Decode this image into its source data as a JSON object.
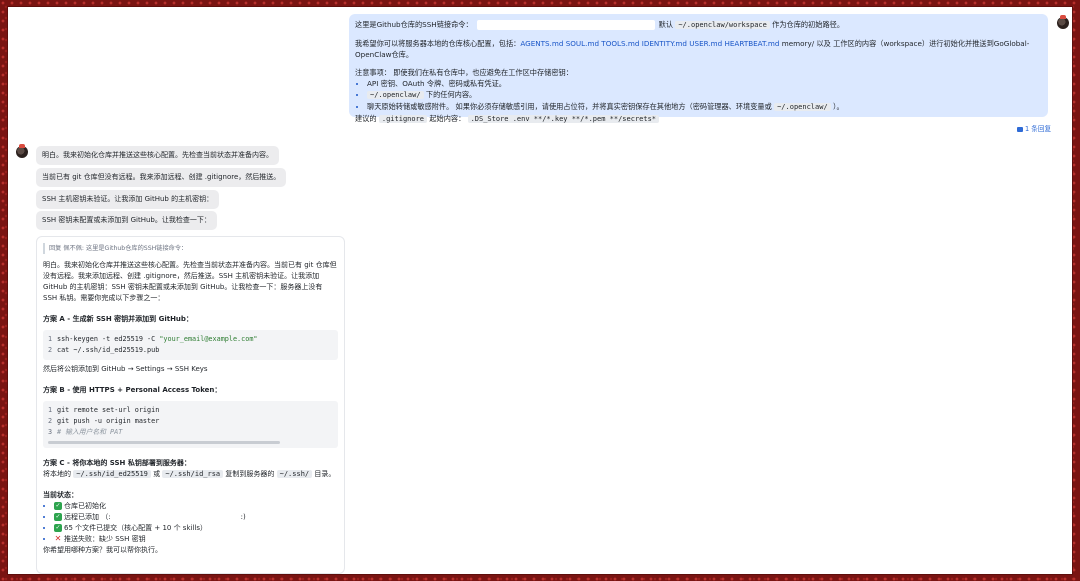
{
  "user_message": {
    "line1_prefix": "这里是Github仓库的SSH链接命令：",
    "line1_default": "默认",
    "line1_path": "~/.openclaw/workspace",
    "line1_suffix": "作为仓库的初始路径。",
    "line2_prefix": "我希望你可以将服务器本地的仓库核心配置，包括：",
    "line2_files": "AGENTS.md SOUL.md TOOLS.md IDENTITY.md USER.md HEARTBEAT.md",
    "line2_suffix": "memory/ 以及 工作区的内容（workspace）进行初始化并推送到GoGlobal-OpenClaw仓库。",
    "notes_title": "注意事项： 即使我们在私有仓库中，也应避免在工作区中存储密钥：",
    "notes": [
      {
        "text": "API 密钥、OAuth 令牌、密码或私有凭证。",
        "code": "",
        "tail": ""
      },
      {
        "text": "",
        "code": "~/.openclaw/",
        "tail": "下的任何内容。"
      },
      {
        "text": "聊天原始转储或敏感附件。 如果你必须存储敏感引用，请使用占位符，并将真实密钥保存在其他地方（密码管理器、环境变量或",
        "code": "~/.openclaw/",
        "tail": "）。"
      }
    ],
    "gitignore_label": "建议的",
    "gitignore_file": ".gitignore",
    "gitignore_mid": "起始内容：",
    "gitignore_content": ".DS_Store .env **/*.key **/*.pem **/secrets*"
  },
  "reply_count": "1 条回复",
  "assistant_bubbles": [
    "明白。我来初始化仓库并推送这些核心配置。先检查当前状态并准备内容。",
    "当前已有 git 仓库但没有远程。我来添加远程、创建 .gitignore，然后推送。",
    "SSH 主机密钥未验证。让我添加 GitHub 的主机密钥：",
    "SSH 密钥未配置或未添加到 GitHub。让我检查一下："
  ],
  "card": {
    "quote": "回复 佩不佩: 这里是Github仓库的SSH链接命令：",
    "summary": "明白。我来初始化仓库并推送这些核心配置。先检查当前状态并准备内容。当前已有 git 仓库但没有远程。我来添加远程、创建 .gitignore，然后推送。SSH 主机密钥未验证。让我添加 GitHub 的主机密钥：SSH 密钥未配置或未添加到 GitHub。让我检查一下：服务器上没有 SSH 私钥。需要你完成以下步骤之一：",
    "plan_a_title": "方案 A - 生成新 SSH 密钥并添加到 GitHub：",
    "plan_a_code": [
      {
        "n": "1",
        "cmd": "ssh-keygen -t ed25519 -C ",
        "str": "\"your_email@example.com\""
      },
      {
        "n": "2",
        "cmd": "cat ~/.ssh/id_ed25519.pub",
        "str": ""
      }
    ],
    "plan_a_after": "然后将公钥添加到 GitHub → Settings → SSH Keys",
    "plan_b_title": "方案 B - 使用 HTTPS + Personal Access Token：",
    "plan_b_code": [
      {
        "n": "1",
        "cmd": "git remote set-url origin",
        "cmt": ""
      },
      {
        "n": "2",
        "cmd": "git push -u origin master",
        "cmt": ""
      },
      {
        "n": "3",
        "cmd": "",
        "cmt": "# 输入用户名和 PAT"
      }
    ],
    "plan_c_title": "方案 C - 将你本地的 SSH 私钥部署到服务器：",
    "plan_c_pre": "将本地的",
    "plan_c_code1": "~/.ssh/id_ed25519",
    "plan_c_or": "或",
    "plan_c_code2": "~/.ssh/id_rsa",
    "plan_c_mid": "复制到服务器的",
    "plan_c_code3": "~/.ssh/",
    "plan_c_tail": "目录。",
    "status_title": "当前状态：",
    "status_items": [
      {
        "ok": true,
        "text": "仓库已初始化",
        "extra": ""
      },
      {
        "ok": true,
        "text": "远程已添加 （:",
        "extra": ":)"
      },
      {
        "ok": true,
        "text": "65 个文件已提交（核心配置 + 10 个 skills）",
        "extra": ""
      },
      {
        "ok": false,
        "text": "推送失败：缺少 SSH 密钥",
        "extra": ""
      }
    ],
    "question": "你希望用哪种方案？我可以帮你执行。"
  },
  "colors": {
    "user_bubble": "#dbe8ff",
    "link": "#1a56c8",
    "assistant_bubble": "#ececee",
    "border": "#7a1412"
  }
}
